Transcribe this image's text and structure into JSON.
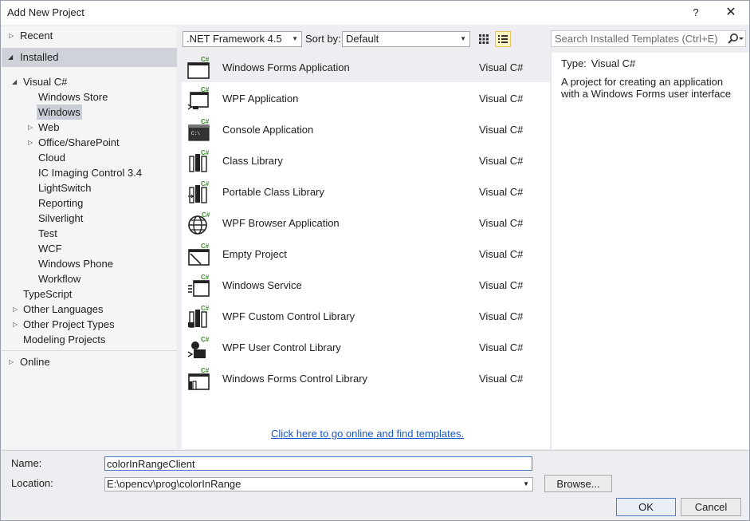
{
  "window": {
    "title": "Add New Project",
    "help": "?",
    "close": "✕"
  },
  "nav": {
    "recent": "Recent",
    "installed": "Installed",
    "visual_csharp": "Visual C#",
    "children": [
      "Windows Store",
      "Windows",
      "Web",
      "Office/SharePoint",
      "Cloud",
      "IC Imaging Control 3.4",
      "LightSwitch",
      "Reporting",
      "Silverlight",
      "Test",
      "WCF",
      "Windows Phone",
      "Workflow"
    ],
    "typescript": "TypeScript",
    "other_languages": "Other Languages",
    "other_project_types": "Other Project Types",
    "modeling_projects": "Modeling Projects",
    "online": "Online",
    "selected": "Windows"
  },
  "toolbar": {
    "framework": ".NET Framework 4.5",
    "sort_label": "Sort by:",
    "sort_value": "Default",
    "search_placeholder": "Search Installed Templates (Ctrl+E)"
  },
  "templates": [
    {
      "name": "Windows Forms Application",
      "lang": "Visual C#",
      "icon": "winforms-icon"
    },
    {
      "name": "WPF Application",
      "lang": "Visual C#",
      "icon": "wpf-app-icon"
    },
    {
      "name": "Console Application",
      "lang": "Visual C#",
      "icon": "console-icon"
    },
    {
      "name": "Class Library",
      "lang": "Visual C#",
      "icon": "class-library-icon"
    },
    {
      "name": "Portable Class Library",
      "lang": "Visual C#",
      "icon": "portable-library-icon"
    },
    {
      "name": "WPF Browser Application",
      "lang": "Visual C#",
      "icon": "globe-icon"
    },
    {
      "name": "Empty Project",
      "lang": "Visual C#",
      "icon": "empty-project-icon"
    },
    {
      "name": "Windows Service",
      "lang": "Visual C#",
      "icon": "service-icon"
    },
    {
      "name": "WPF Custom Control Library",
      "lang": "Visual C#",
      "icon": "custom-control-icon"
    },
    {
      "name": "WPF User Control Library",
      "lang": "Visual C#",
      "icon": "user-control-icon"
    },
    {
      "name": "Windows Forms Control Library",
      "lang": "Visual C#",
      "icon": "forms-control-icon"
    }
  ],
  "online_link": "Click here to go online and find templates.",
  "details": {
    "type_label": "Type:",
    "type_value": "Visual C#",
    "description": "A project for creating an application with a Windows Forms user interface"
  },
  "form": {
    "name_label": "Name:",
    "name_value": "colorInRangeClient",
    "location_label": "Location:",
    "location_value": "E:\\opencv\\prog\\colorInRange",
    "browse": "Browse...",
    "ok": "OK",
    "cancel": "Cancel"
  },
  "colors": {
    "accent": "#4d7ec7",
    "selection": "#cfd2d8",
    "link": "#1a56c8",
    "csharp_green": "#3f8c2f"
  }
}
